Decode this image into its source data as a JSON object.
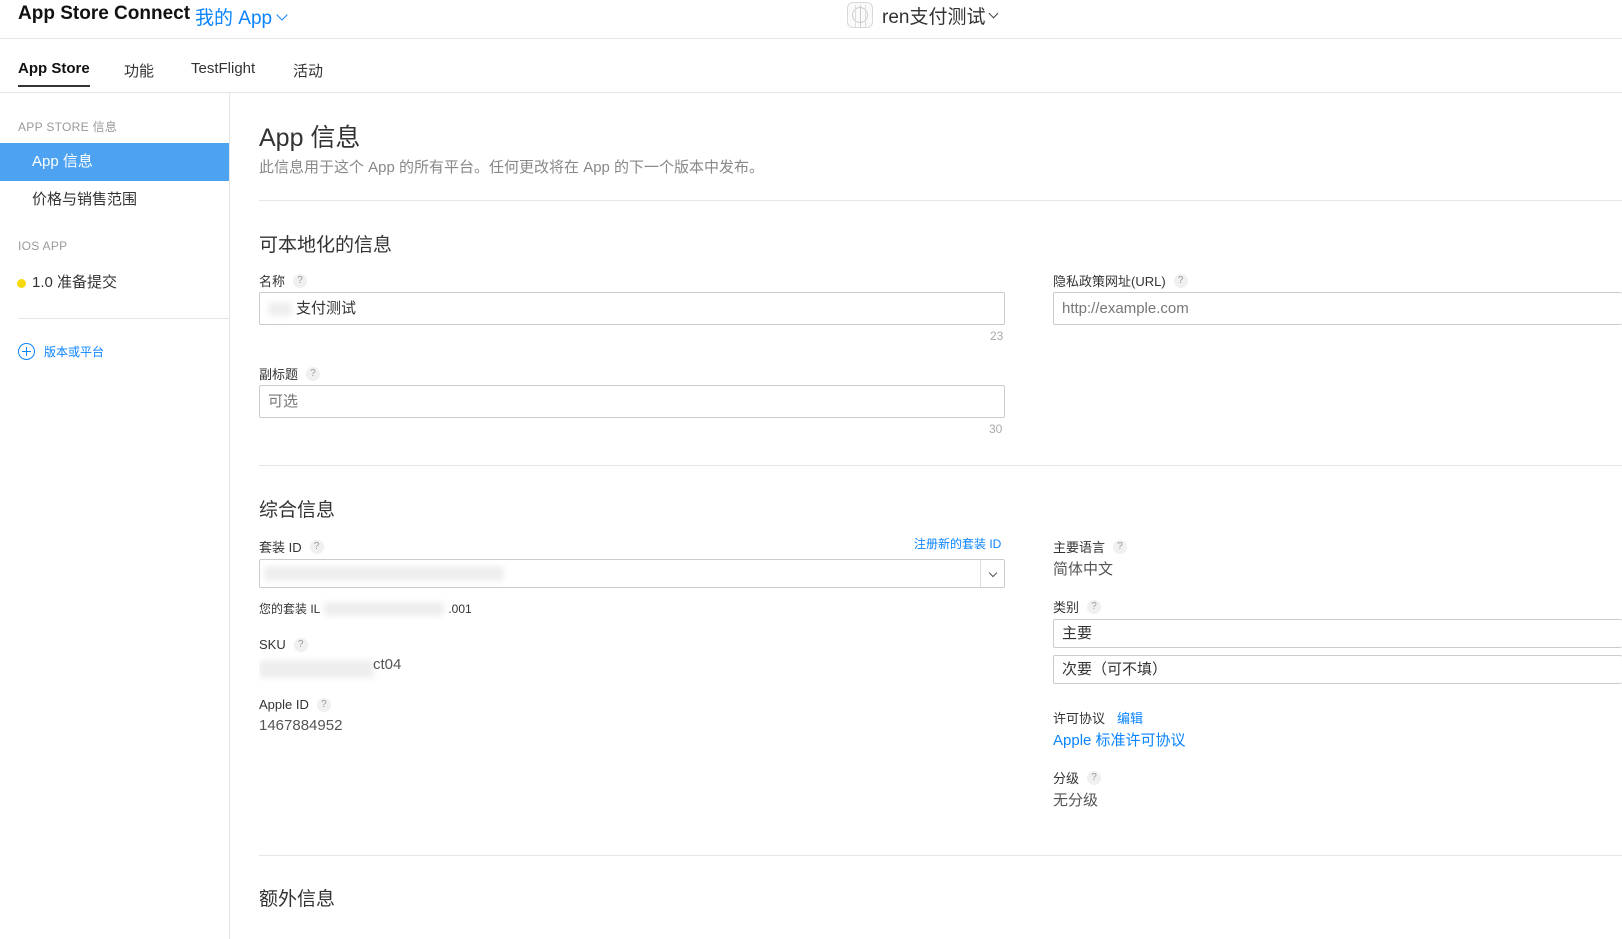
{
  "header": {
    "brand": "App Store Connect",
    "my_apps": "我的 App",
    "app_name": "ren支付测试"
  },
  "tabs": [
    {
      "label": "App Store"
    },
    {
      "label": "功能"
    },
    {
      "label": "TestFlight"
    },
    {
      "label": "活动"
    }
  ],
  "sidebar": {
    "section1": "APP STORE 信息",
    "items": [
      {
        "label": "App 信息"
      },
      {
        "label": "价格与销售范围"
      }
    ],
    "section2": "IOS APP",
    "version_item": "1.0 准备提交",
    "add_label": "版本或平台"
  },
  "main": {
    "title": "App 信息",
    "subtitle": "此信息用于这个 App 的所有平台。任何更改将在 App 的下一个版本中发布。",
    "localizable": {
      "title": "可本地化的信息",
      "name_label": "名称",
      "name_value": "支付测试",
      "name_counter": "23",
      "subtitle_label": "副标题",
      "subtitle_placeholder": "可选",
      "subtitle_counter": "30",
      "privacy_label": "隐私政策网址(URL)",
      "privacy_placeholder": "http://example.com"
    },
    "general": {
      "title": "综合信息",
      "bundle_label": "套装 ID",
      "register_link": "注册新的套装 ID",
      "bundle_note_prefix": "您的套装 IL",
      "bundle_note_suffix": ".001",
      "sku_label": "SKU",
      "sku_value_suffix": "ct04",
      "apple_id_label": "Apple ID",
      "apple_id_value": "1467884952",
      "primary_lang_label": "主要语言",
      "primary_lang_value": "简体中文",
      "category_label": "类别",
      "category_primary": "主要",
      "category_secondary": "次要（可不填）",
      "license_label": "许可协议",
      "license_edit": "编辑",
      "license_link": "Apple 标准许可协议",
      "rating_label": "分级",
      "rating_value": "无分级",
      "help_glyph": "?"
    },
    "extra": {
      "title": "额外信息"
    }
  }
}
